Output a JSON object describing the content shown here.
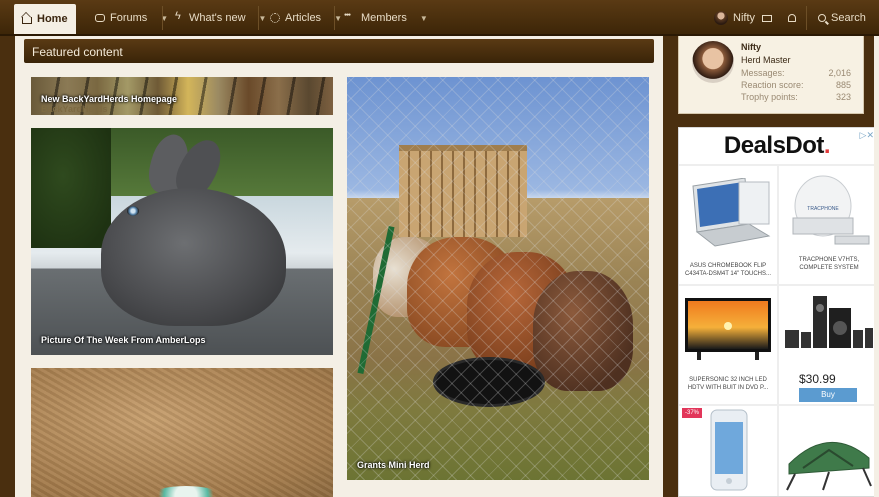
{
  "nav": {
    "home": "Home",
    "forums": "Forums",
    "whats_new": "What's new",
    "articles": "Articles",
    "members": "Members",
    "user": "Nifty",
    "search": "Search"
  },
  "featured": {
    "heading": "Featured content",
    "banner_caption": "New BackYardHerds Homepage",
    "banner_sub": "BackYardHerds",
    "bunny_caption": "Picture Of The Week From AmberLops",
    "cows_caption": "Grants Mini Herd"
  },
  "profile": {
    "name": "Nifty",
    "rank": "Herd Master",
    "stats": [
      {
        "label": "Messages:",
        "value": "2,016"
      },
      {
        "label": "Reaction score:",
        "value": "885"
      },
      {
        "label": "Trophy points:",
        "value": "323"
      }
    ]
  },
  "ad": {
    "brand": "DealsDot",
    "brand_dot": ".",
    "corner": "▷✕",
    "products": [
      {
        "name": "ASUS CHROMEBOOK FLIP C434TA-DSM4T 14\" TOUCHS..."
      },
      {
        "name": "TRACPHONE V7HTS, COMPLETE SYSTEM"
      },
      {
        "name": "SUPERSONIC 32 INCH LED HDTV WITH BUIT IN DVD P..."
      }
    ],
    "price": "$30.99",
    "buy": "Buy",
    "discount": "-37%"
  },
  "colors": {
    "nav_bg": "#4a2f0f",
    "panel_bg": "#f4efe5",
    "accent_red": "#e23a3a",
    "buy_blue": "#5b9bd0"
  }
}
